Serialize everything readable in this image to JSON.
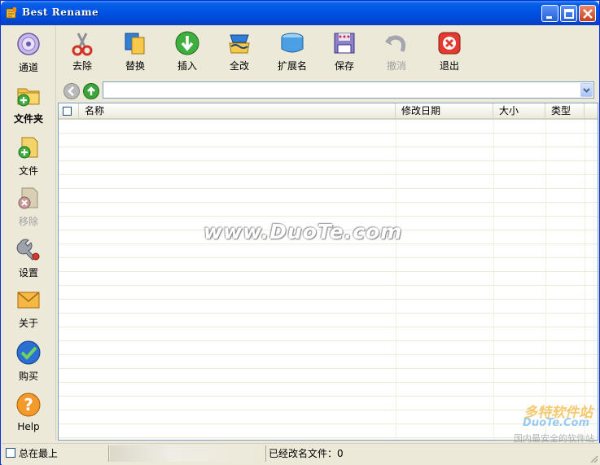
{
  "window": {
    "title": "Best Rename"
  },
  "sidebar": {
    "items": [
      {
        "label": "通道",
        "icon": "channel-disc-icon"
      },
      {
        "label": "文件夹",
        "icon": "add-folder-icon",
        "active": true
      },
      {
        "label": "文件",
        "icon": "add-file-icon"
      },
      {
        "label": "移除",
        "icon": "remove-icon",
        "disabled": true
      },
      {
        "label": "设置",
        "icon": "wrench-settings-icon"
      },
      {
        "label": "关于",
        "icon": "envelope-about-icon"
      },
      {
        "label": "购买",
        "icon": "checkmark-buy-icon"
      },
      {
        "label": "Help",
        "icon": "help-icon"
      }
    ]
  },
  "toolbar": {
    "items": [
      {
        "label": "去除",
        "icon": "scissors-icon"
      },
      {
        "label": "替换",
        "icon": "replace-icon"
      },
      {
        "label": "插入",
        "icon": "insert-arrow-icon"
      },
      {
        "label": "全改",
        "icon": "change-all-icon"
      },
      {
        "label": "扩展名",
        "icon": "extension-icon"
      },
      {
        "label": "保存",
        "icon": "save-icon"
      },
      {
        "label": "撤消",
        "icon": "undo-icon",
        "disabled": true
      },
      {
        "label": "退出",
        "icon": "exit-icon"
      }
    ]
  },
  "address": {
    "path": ""
  },
  "list": {
    "columns": [
      "名称",
      "修改日期",
      "大小",
      "类型"
    ],
    "rows": []
  },
  "watermark": "www.DuoTe.com",
  "corner_logo": {
    "line1": "多特软件站",
    "line2": "DuoTe.Com",
    "line3": "国内最安全的软件站"
  },
  "statusbar": {
    "always_on_top_label": "总在最上",
    "renamed_count_text": "已经改名文件：0"
  },
  "colors": {
    "titlebar": "#0055e5",
    "face": "#ece9d8",
    "border": "#7f9db9"
  }
}
